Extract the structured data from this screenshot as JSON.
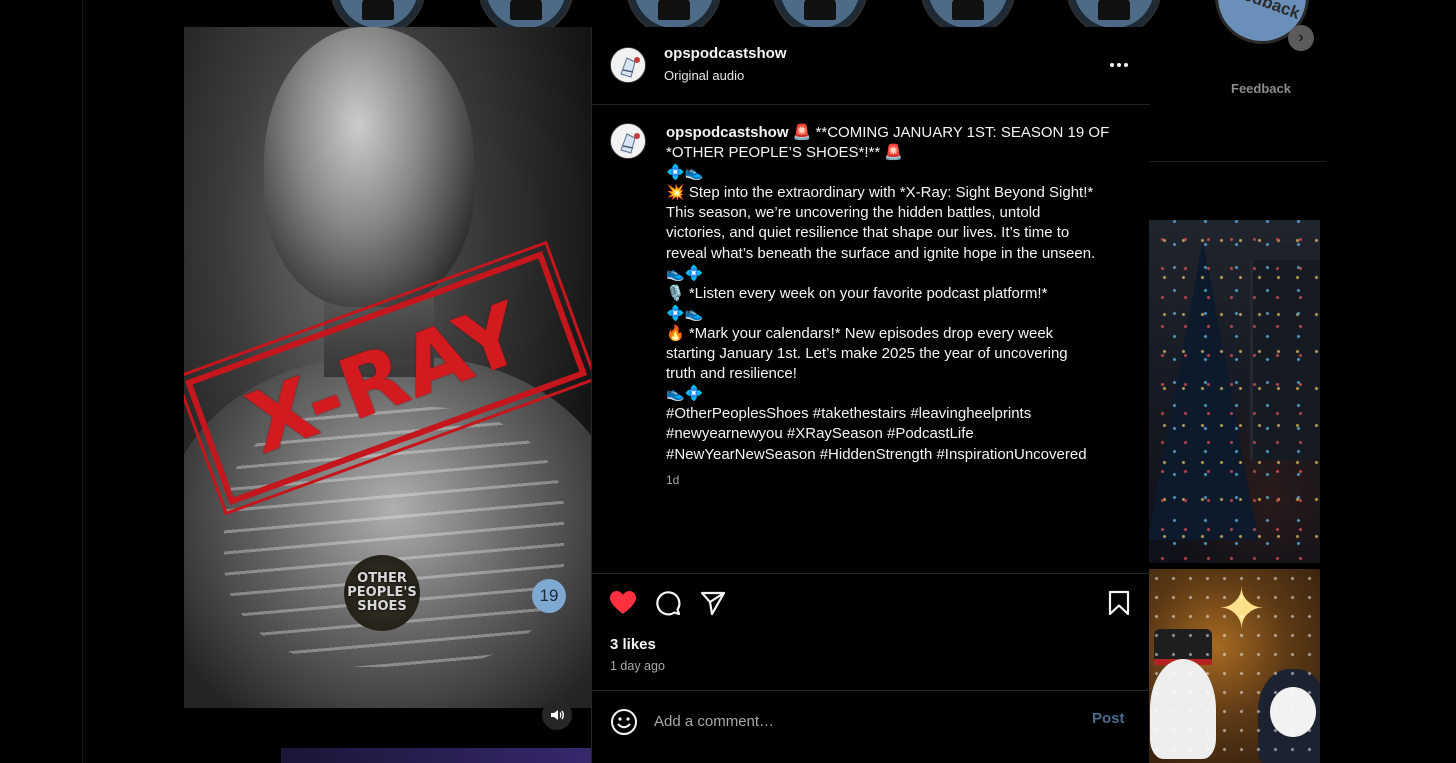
{
  "highlights": {
    "feedback_label": "Feedback",
    "feedback_circle_text": "Feedback"
  },
  "post": {
    "username": "opspodcastshow",
    "audio_label": "Original audio",
    "media": {
      "stamp_text": "X-RAY",
      "brand_text": "OTHER PEOPLE'S SHOES",
      "carousel_count": "19"
    },
    "caption": {
      "username": "opspodcastshow",
      "lines": [
        "🚨 **COMING JANUARY 1ST: SEASON 19 OF",
        "*OTHER PEOPLE’S SHOES*!** 🚨",
        "💠👟",
        "💥 Step into the extraordinary with *X-Ray: Sight Beyond Sight!*",
        "This season, we’re uncovering the hidden battles, untold",
        "victories, and quiet resilience that shape our lives. It’s time to",
        "reveal what’s beneath the surface and ignite hope in the unseen.",
        "👟💠",
        "🎙️ *Listen every week on your favorite podcast platform!*",
        "💠👟",
        "🔥 *Mark your calendars!* New episodes drop every week",
        "starting January 1st. Let’s make 2025 the year of uncovering",
        "truth and resilience!",
        "👟💠",
        "#OtherPeoplesShoes #takethestairs #leavingheelprints",
        "#newyearnewyou #XRaySeason #PodcastLife",
        "#NewYearNewSeason #HiddenStrength #InspirationUncovered"
      ],
      "time": "1d"
    },
    "likes": "3 likes",
    "posted_ago": "1 day ago",
    "comment": {
      "placeholder": "Add a comment…",
      "post_label": "Post"
    },
    "liked": true,
    "colors": {
      "like": "#ff3040",
      "stamp": "#d21a1f",
      "post_button": "#4c6b8a"
    }
  }
}
